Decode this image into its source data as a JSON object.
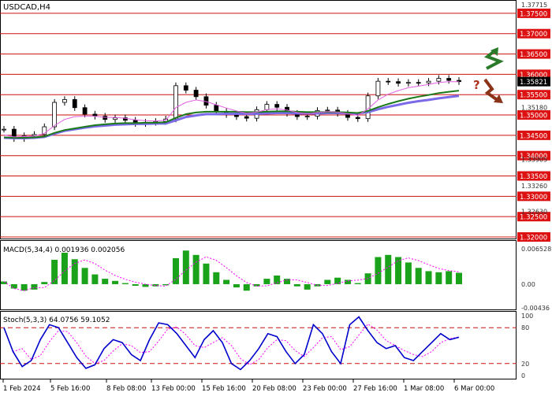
{
  "chart_title": "USDCAD,H4",
  "colors": {
    "level_line": "#cc1111",
    "level_label_bg": "#dd1111",
    "candle": "#000000",
    "ma_fast": "#e060e0",
    "ma_mid": "#1a7a1a",
    "ma_slow": "#7a6ae8",
    "macd_hist": "#1aa31a",
    "macd_signal": "#ff00ff",
    "stoch_main": "#0000cc",
    "stoch_signal": "#ff00ff",
    "stoch_level": "#cc1111",
    "arrow_up": "#2a7a2a",
    "arrow_down": "#8a3318",
    "question": "#b03020"
  },
  "icons": {
    "up_arrow": "green-zigzag-up-arrow",
    "down_arrow": "brown-zigzag-down-arrow",
    "question": "question-mark"
  },
  "question_mark": "?",
  "red_levels": [
    "1.37500",
    "1.37000",
    "1.36500",
    "1.36000",
    "1.35500",
    "1.35000",
    "1.34500",
    "1.34000",
    "1.33500",
    "1.33000",
    "1.32500",
    "1.32000"
  ],
  "gray_price_labels": [
    "1.37715",
    "1.35180",
    "1.33905",
    "1.33260",
    "1.32630"
  ],
  "current_price": "1.35821",
  "macd": {
    "label": "MACD(5,34,4) 0.001936 0.002056",
    "scale": [
      "0.006528",
      "0.00",
      "-0.00436"
    ]
  },
  "stoch": {
    "label": "Stoch(5,3,3) 64.0756 59.1052",
    "scale": [
      "100",
      "80",
      "20",
      "0"
    ]
  },
  "x_labels": [
    "1 Feb 2024",
    "5 Feb 16:00",
    "8 Feb 08:00",
    "13 Feb 00:00",
    "15 Feb 16:00",
    "20 Feb 08:00",
    "23 Feb 00:00",
    "27 Feb 16:00",
    "1 Mar 08:00",
    "6 Mar 00:00"
  ],
  "chart_data": {
    "type": "line",
    "series": [
      {
        "values": [
          1.3465,
          1.3442,
          1.3449,
          1.3452,
          1.3471,
          1.3531,
          1.3538,
          1.3518,
          1.3502,
          1.3497,
          1.3489,
          1.3493,
          1.3487,
          1.3479,
          1.3482,
          1.3484,
          1.349,
          1.3572,
          1.3561,
          1.3545,
          1.3524,
          1.3509,
          1.3501,
          1.3496,
          1.3492,
          1.3513,
          1.3526,
          1.3519,
          1.3504,
          1.3496,
          1.3497,
          1.3511,
          1.3512,
          1.3504,
          1.3494,
          1.3491,
          1.3547,
          1.3583,
          1.3582,
          1.3578,
          1.358,
          1.3579,
          1.3583,
          1.359,
          1.3585,
          1.3582
        ]
      },
      {
        "values": [
          1.3451,
          1.3446,
          1.3447,
          1.3448,
          1.3455,
          1.3474,
          1.3489,
          1.3496,
          1.3497,
          1.3497,
          1.3494,
          1.3494,
          1.3492,
          1.3488,
          1.3486,
          1.3485,
          1.3487,
          1.3518,
          1.3531,
          1.3537,
          1.3533,
          1.3525,
          1.3517,
          1.351,
          1.3504,
          1.3507,
          1.3513,
          1.3515,
          1.3512,
          1.3506,
          1.3503,
          1.3506,
          1.3508,
          1.3507,
          1.3503,
          1.3499,
          1.3515,
          1.3537,
          1.3551,
          1.356,
          1.3567,
          1.3571,
          1.3575,
          1.358,
          1.3582,
          1.3582
        ]
      },
      {
        "values": [
          1.3445,
          1.3444,
          1.3444,
          1.3445,
          1.3447,
          1.3456,
          1.3463,
          1.3467,
          1.3471,
          1.3475,
          1.3477,
          1.3479,
          1.348,
          1.348,
          1.3481,
          1.3481,
          1.3482,
          1.3493,
          1.3502,
          1.3506,
          1.3508,
          1.3508,
          1.3508,
          1.3508,
          1.3507,
          1.3507,
          1.3508,
          1.3509,
          1.3509,
          1.3508,
          1.3507,
          1.3507,
          1.3507,
          1.3507,
          1.3506,
          1.3505,
          1.351,
          1.3519,
          1.3527,
          1.3534,
          1.354,
          1.3545,
          1.3549,
          1.3554,
          1.3557,
          1.356
        ]
      },
      {
        "values": [
          1.3444,
          1.3443,
          1.3443,
          1.3444,
          1.3446,
          1.3454,
          1.3461,
          1.3465,
          1.3469,
          1.3472,
          1.3474,
          1.3476,
          1.3477,
          1.3478,
          1.3478,
          1.3479,
          1.3479,
          1.3487,
          1.3495,
          1.3499,
          1.3502,
          1.3502,
          1.3503,
          1.3503,
          1.3503,
          1.3503,
          1.3504,
          1.3505,
          1.3505,
          1.3504,
          1.3504,
          1.3504,
          1.3505,
          1.3505,
          1.3504,
          1.3504,
          1.3507,
          1.3514,
          1.352,
          1.3525,
          1.353,
          1.3534,
          1.3537,
          1.3541,
          1.3544,
          1.3547
        ]
      },
      {
        "values": [
          0.0005,
          -0.0008,
          -0.0012,
          -0.001,
          0.0004,
          0.0045,
          0.0058,
          0.0046,
          0.003,
          0.0018,
          0.001,
          0.0006,
          0.0002,
          -0.0003,
          -0.0005,
          -0.0004,
          -0.0002,
          0.0048,
          0.0062,
          0.0054,
          0.0038,
          0.0022,
          0.0008,
          -0.0006,
          -0.0012,
          -0.0004,
          0.001,
          0.0016,
          0.001,
          -0.0004,
          -0.001,
          -0.0004,
          0.0008,
          0.0012,
          0.0008,
          0.0002,
          0.002,
          0.005,
          0.0054,
          0.005,
          0.004,
          0.003,
          0.0024,
          0.0022,
          0.0024,
          0.0021
        ]
      },
      {
        "values": [
          80,
          40,
          15,
          25,
          60,
          85,
          80,
          55,
          30,
          12,
          18,
          45,
          60,
          55,
          35,
          25,
          60,
          88,
          85,
          70,
          50,
          30,
          60,
          75,
          55,
          20,
          10,
          25,
          45,
          70,
          65,
          40,
          20,
          35,
          85,
          70,
          40,
          20,
          85,
          98,
          75,
          55,
          45,
          50,
          30,
          25,
          40,
          55,
          70,
          60,
          64
        ]
      }
    ]
  }
}
